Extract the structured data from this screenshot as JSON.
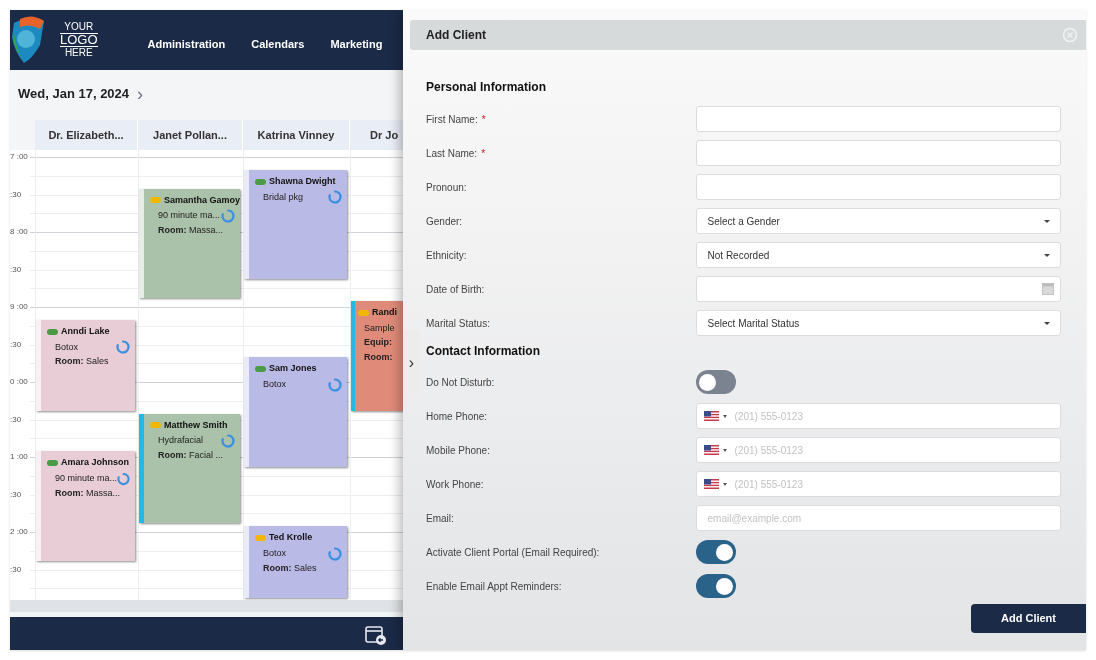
{
  "nav": {
    "logo_text": [
      "YOUR",
      "LOGO",
      "HERE"
    ],
    "items": [
      "Administration",
      "Calendars",
      "Marketing"
    ]
  },
  "calendar": {
    "date": "Wed, Jan 17, 2024",
    "next": "›",
    "time_labels": [
      "7 :00",
      ":30",
      "8 :00",
      ":30",
      "9 :00",
      ":30",
      "0 :00",
      ":30",
      "1 :00",
      ":30",
      "2 :00",
      ":30"
    ],
    "columns": [
      {
        "name": "Dr. Elizabeth...",
        "appointments": [
          {
            "client": "Anndi Lake",
            "service": "Botox",
            "details": [
              {
                "label": "Room:",
                "value": "Sales"
              }
            ],
            "color": "#4a9a48",
            "accent": false
          },
          {
            "client": "Amara Johnson",
            "service": "90 minute ma...",
            "details": [
              {
                "label": "Room:",
                "value": "Massa..."
              }
            ],
            "color": "#4a9a48",
            "accent": false
          }
        ]
      },
      {
        "name": "Janet Pollan...",
        "appointments": [
          {
            "client": "Samantha Gamoy",
            "service": "90 minute ma...",
            "details": [
              {
                "label": "Room:",
                "value": "Massa..."
              }
            ],
            "color": "#f2b705",
            "accent": false
          },
          {
            "client": "Matthew Smith",
            "service": "Hydrafacial",
            "details": [
              {
                "label": "Room:",
                "value": "Facial ..."
              }
            ],
            "color": "#f2b705",
            "accent": true
          }
        ]
      },
      {
        "name": "Katrina Vinney",
        "appointments": [
          {
            "client": "Shawna Dwight",
            "service": "Bridal pkg",
            "color": "#4a9a48",
            "accent": false
          },
          {
            "client": "Sam Jones",
            "service": "Botox",
            "color": "#4a9a48",
            "accent": false
          },
          {
            "client": "Ted Krolle",
            "service": "Botox",
            "details": [
              {
                "label": "Room:",
                "value": "Sales"
              }
            ],
            "color": "#f2b705",
            "accent": false
          }
        ]
      },
      {
        "name": "Dr Jo",
        "appointments": [
          {
            "client": "Randi",
            "service": "Sample",
            "details": [
              {
                "label": "Equip:"
              },
              {
                "label": "Room:"
              }
            ],
            "color": "#f2b705",
            "accent": true
          }
        ]
      }
    ]
  },
  "panel": {
    "title": "Add Client",
    "collapse": "›",
    "sections": [
      {
        "heading": "Personal Information",
        "fields": [
          {
            "kind": "text",
            "label": "First Name:",
            "required_mark": "*"
          },
          {
            "kind": "text",
            "label": "Last Name:",
            "required_mark": "*"
          },
          {
            "kind": "text",
            "label": "Pronoun:"
          },
          {
            "kind": "select",
            "label": "Gender:",
            "value": "Select a Gender"
          },
          {
            "kind": "select",
            "label": "Ethnicity:",
            "value": "Not Recorded"
          },
          {
            "kind": "date",
            "label": "Date of Birth:"
          },
          {
            "kind": "select",
            "label": "Marital Status:",
            "value": "Select Marital Status"
          }
        ]
      },
      {
        "heading": "Contact Information",
        "fields": [
          {
            "kind": "toggle",
            "label": "Do Not Disturb:",
            "on": false
          },
          {
            "kind": "phone",
            "label": "Home Phone:",
            "placeholder": "(201) 555-0123"
          },
          {
            "kind": "phone",
            "label": "Mobile Phone:",
            "placeholder": "(201) 555-0123"
          },
          {
            "kind": "phone",
            "label": "Work Phone:",
            "placeholder": "(201) 555-0123"
          },
          {
            "kind": "email",
            "label": "Email:",
            "placeholder": "email@example.com"
          },
          {
            "kind": "toggle",
            "label": "Activate Client Portal (Email Required):",
            "on": true
          },
          {
            "kind": "toggle",
            "label": "Enable Email Appt Reminders:",
            "on": true
          }
        ]
      }
    ],
    "submit": "Add Client"
  }
}
